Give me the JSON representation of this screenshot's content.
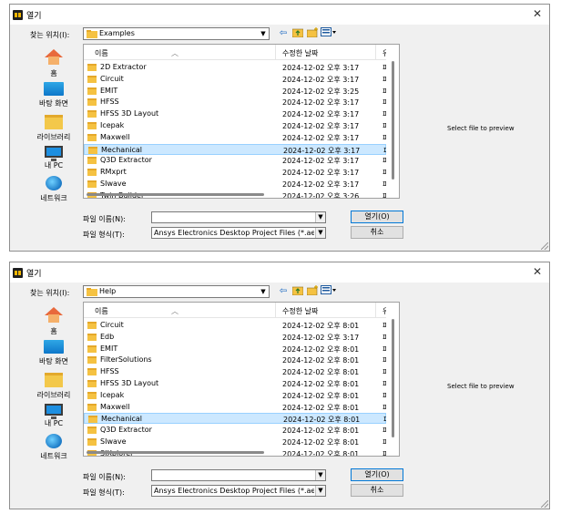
{
  "dialogs": [
    {
      "title": "열기",
      "close_label": "✕",
      "look_in_label": "찾는 위치(I):",
      "look_in_value": "Examples",
      "places": {
        "home": "홈",
        "desktop": "바탕 화면",
        "library": "라이브러리",
        "pc": "내 PC",
        "network": "네트워크"
      },
      "columns": {
        "name": "이름",
        "date": "수정한 날짜",
        "type": "유형"
      },
      "rows": [
        {
          "name": "2D Extractor",
          "date": "2024-12-02 오후 3:17",
          "type": "파일 폴더",
          "selected": false
        },
        {
          "name": "Circuit",
          "date": "2024-12-02 오후 3:17",
          "type": "파일 폴더",
          "selected": false
        },
        {
          "name": "EMIT",
          "date": "2024-12-02 오후 3:25",
          "type": "파일 폴더",
          "selected": false
        },
        {
          "name": "HFSS",
          "date": "2024-12-02 오후 3:17",
          "type": "파일 폴더",
          "selected": false
        },
        {
          "name": "HFSS 3D Layout",
          "date": "2024-12-02 오후 3:17",
          "type": "파일 폴더",
          "selected": false
        },
        {
          "name": "Icepak",
          "date": "2024-12-02 오후 3:17",
          "type": "파일 폴더",
          "selected": false
        },
        {
          "name": "Maxwell",
          "date": "2024-12-02 오후 3:17",
          "type": "파일 폴더",
          "selected": false
        },
        {
          "name": "Mechanical",
          "date": "2024-12-02 오후 3:17",
          "type": "파일 폴더",
          "selected": true
        },
        {
          "name": "Q3D Extractor",
          "date": "2024-12-02 오후 3:17",
          "type": "파일 폴더",
          "selected": false
        },
        {
          "name": "RMxprt",
          "date": "2024-12-02 오후 3:17",
          "type": "파일 폴더",
          "selected": false
        },
        {
          "name": "SIwave",
          "date": "2024-12-02 오후 3:17",
          "type": "파일 폴더",
          "selected": false
        },
        {
          "name": "Twin Builder",
          "date": "2024-12-02 오후 3:26",
          "type": "파일 폴더",
          "selected": false
        }
      ],
      "preview_text": "Select file to preview",
      "file_name_label": "파일 이름(N):",
      "file_name_value": "",
      "file_type_label": "파일 형식(T):",
      "file_type_value": "Ansys Electronics Desktop Project Files (*.aedt)",
      "open_label": "열기(O)",
      "cancel_label": "취소"
    },
    {
      "title": "열기",
      "close_label": "✕",
      "look_in_label": "찾는 위치(I):",
      "look_in_value": "Help",
      "places": {
        "home": "홈",
        "desktop": "바탕 화면",
        "library": "라이브러리",
        "pc": "내 PC",
        "network": "네트워크"
      },
      "columns": {
        "name": "이름",
        "date": "수정한 날짜",
        "type": "유형"
      },
      "rows": [
        {
          "name": "Circuit",
          "date": "2024-12-02 오후 8:01",
          "type": "파일 폴더",
          "selected": false
        },
        {
          "name": "Edb",
          "date": "2024-12-02 오후 3:17",
          "type": "파일 폴더",
          "selected": false
        },
        {
          "name": "EMIT",
          "date": "2024-12-02 오후 8:01",
          "type": "파일 폴더",
          "selected": false
        },
        {
          "name": "FilterSolutions",
          "date": "2024-12-02 오후 8:01",
          "type": "파일 폴더",
          "selected": false
        },
        {
          "name": "HFSS",
          "date": "2024-12-02 오후 8:01",
          "type": "파일 폴더",
          "selected": false
        },
        {
          "name": "HFSS 3D Layout",
          "date": "2024-12-02 오후 8:01",
          "type": "파일 폴더",
          "selected": false
        },
        {
          "name": "Icepak",
          "date": "2024-12-02 오후 8:01",
          "type": "파일 폴더",
          "selected": false
        },
        {
          "name": "Maxwell",
          "date": "2024-12-02 오후 8:01",
          "type": "파일 폴더",
          "selected": false
        },
        {
          "name": "Mechanical",
          "date": "2024-12-02 오후 8:01",
          "type": "파일 폴더",
          "selected": true
        },
        {
          "name": "Q3D Extractor",
          "date": "2024-12-02 오후 8:01",
          "type": "파일 폴더",
          "selected": false
        },
        {
          "name": "SIwave",
          "date": "2024-12-02 오후 8:01",
          "type": "파일 폴더",
          "selected": false
        },
        {
          "name": "SIXplorer",
          "date": "2024-12-02 오후 8:01",
          "type": "파일 폴더",
          "selected": false
        }
      ],
      "preview_text": "Select file to preview",
      "file_name_label": "파일 이름(N):",
      "file_name_value": "",
      "file_type_label": "파일 형식(T):",
      "file_type_value": "Ansys Electronics Desktop Project Files (*.aedt)",
      "open_label": "열기(O)",
      "cancel_label": "취소"
    }
  ]
}
